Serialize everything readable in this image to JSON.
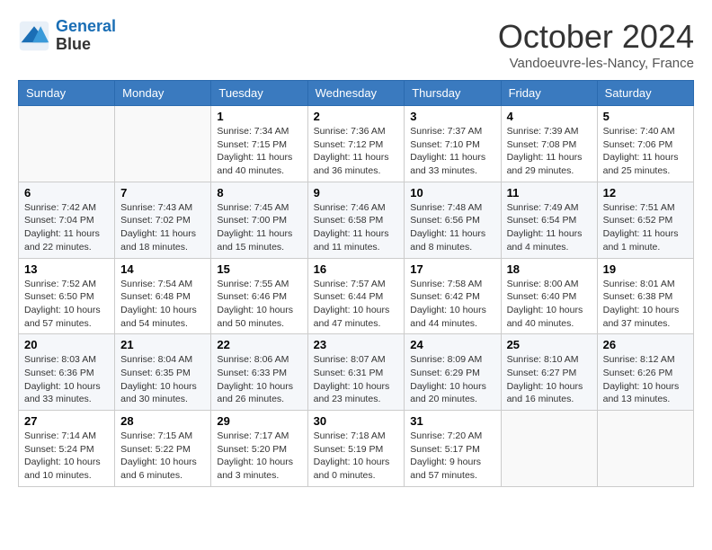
{
  "header": {
    "logo_line1": "General",
    "logo_line2": "Blue",
    "month_title": "October 2024",
    "subtitle": "Vandoeuvre-les-Nancy, France"
  },
  "weekdays": [
    "Sunday",
    "Monday",
    "Tuesday",
    "Wednesday",
    "Thursday",
    "Friday",
    "Saturday"
  ],
  "weeks": [
    [
      {
        "day": "",
        "sunrise": "",
        "sunset": "",
        "daylight": ""
      },
      {
        "day": "",
        "sunrise": "",
        "sunset": "",
        "daylight": ""
      },
      {
        "day": "1",
        "sunrise": "Sunrise: 7:34 AM",
        "sunset": "Sunset: 7:15 PM",
        "daylight": "Daylight: 11 hours and 40 minutes."
      },
      {
        "day": "2",
        "sunrise": "Sunrise: 7:36 AM",
        "sunset": "Sunset: 7:12 PM",
        "daylight": "Daylight: 11 hours and 36 minutes."
      },
      {
        "day": "3",
        "sunrise": "Sunrise: 7:37 AM",
        "sunset": "Sunset: 7:10 PM",
        "daylight": "Daylight: 11 hours and 33 minutes."
      },
      {
        "day": "4",
        "sunrise": "Sunrise: 7:39 AM",
        "sunset": "Sunset: 7:08 PM",
        "daylight": "Daylight: 11 hours and 29 minutes."
      },
      {
        "day": "5",
        "sunrise": "Sunrise: 7:40 AM",
        "sunset": "Sunset: 7:06 PM",
        "daylight": "Daylight: 11 hours and 25 minutes."
      }
    ],
    [
      {
        "day": "6",
        "sunrise": "Sunrise: 7:42 AM",
        "sunset": "Sunset: 7:04 PM",
        "daylight": "Daylight: 11 hours and 22 minutes."
      },
      {
        "day": "7",
        "sunrise": "Sunrise: 7:43 AM",
        "sunset": "Sunset: 7:02 PM",
        "daylight": "Daylight: 11 hours and 18 minutes."
      },
      {
        "day": "8",
        "sunrise": "Sunrise: 7:45 AM",
        "sunset": "Sunset: 7:00 PM",
        "daylight": "Daylight: 11 hours and 15 minutes."
      },
      {
        "day": "9",
        "sunrise": "Sunrise: 7:46 AM",
        "sunset": "Sunset: 6:58 PM",
        "daylight": "Daylight: 11 hours and 11 minutes."
      },
      {
        "day": "10",
        "sunrise": "Sunrise: 7:48 AM",
        "sunset": "Sunset: 6:56 PM",
        "daylight": "Daylight: 11 hours and 8 minutes."
      },
      {
        "day": "11",
        "sunrise": "Sunrise: 7:49 AM",
        "sunset": "Sunset: 6:54 PM",
        "daylight": "Daylight: 11 hours and 4 minutes."
      },
      {
        "day": "12",
        "sunrise": "Sunrise: 7:51 AM",
        "sunset": "Sunset: 6:52 PM",
        "daylight": "Daylight: 11 hours and 1 minute."
      }
    ],
    [
      {
        "day": "13",
        "sunrise": "Sunrise: 7:52 AM",
        "sunset": "Sunset: 6:50 PM",
        "daylight": "Daylight: 10 hours and 57 minutes."
      },
      {
        "day": "14",
        "sunrise": "Sunrise: 7:54 AM",
        "sunset": "Sunset: 6:48 PM",
        "daylight": "Daylight: 10 hours and 54 minutes."
      },
      {
        "day": "15",
        "sunrise": "Sunrise: 7:55 AM",
        "sunset": "Sunset: 6:46 PM",
        "daylight": "Daylight: 10 hours and 50 minutes."
      },
      {
        "day": "16",
        "sunrise": "Sunrise: 7:57 AM",
        "sunset": "Sunset: 6:44 PM",
        "daylight": "Daylight: 10 hours and 47 minutes."
      },
      {
        "day": "17",
        "sunrise": "Sunrise: 7:58 AM",
        "sunset": "Sunset: 6:42 PM",
        "daylight": "Daylight: 10 hours and 44 minutes."
      },
      {
        "day": "18",
        "sunrise": "Sunrise: 8:00 AM",
        "sunset": "Sunset: 6:40 PM",
        "daylight": "Daylight: 10 hours and 40 minutes."
      },
      {
        "day": "19",
        "sunrise": "Sunrise: 8:01 AM",
        "sunset": "Sunset: 6:38 PM",
        "daylight": "Daylight: 10 hours and 37 minutes."
      }
    ],
    [
      {
        "day": "20",
        "sunrise": "Sunrise: 8:03 AM",
        "sunset": "Sunset: 6:36 PM",
        "daylight": "Daylight: 10 hours and 33 minutes."
      },
      {
        "day": "21",
        "sunrise": "Sunrise: 8:04 AM",
        "sunset": "Sunset: 6:35 PM",
        "daylight": "Daylight: 10 hours and 30 minutes."
      },
      {
        "day": "22",
        "sunrise": "Sunrise: 8:06 AM",
        "sunset": "Sunset: 6:33 PM",
        "daylight": "Daylight: 10 hours and 26 minutes."
      },
      {
        "day": "23",
        "sunrise": "Sunrise: 8:07 AM",
        "sunset": "Sunset: 6:31 PM",
        "daylight": "Daylight: 10 hours and 23 minutes."
      },
      {
        "day": "24",
        "sunrise": "Sunrise: 8:09 AM",
        "sunset": "Sunset: 6:29 PM",
        "daylight": "Daylight: 10 hours and 20 minutes."
      },
      {
        "day": "25",
        "sunrise": "Sunrise: 8:10 AM",
        "sunset": "Sunset: 6:27 PM",
        "daylight": "Daylight: 10 hours and 16 minutes."
      },
      {
        "day": "26",
        "sunrise": "Sunrise: 8:12 AM",
        "sunset": "Sunset: 6:26 PM",
        "daylight": "Daylight: 10 hours and 13 minutes."
      }
    ],
    [
      {
        "day": "27",
        "sunrise": "Sunrise: 7:14 AM",
        "sunset": "Sunset: 5:24 PM",
        "daylight": "Daylight: 10 hours and 10 minutes."
      },
      {
        "day": "28",
        "sunrise": "Sunrise: 7:15 AM",
        "sunset": "Sunset: 5:22 PM",
        "daylight": "Daylight: 10 hours and 6 minutes."
      },
      {
        "day": "29",
        "sunrise": "Sunrise: 7:17 AM",
        "sunset": "Sunset: 5:20 PM",
        "daylight": "Daylight: 10 hours and 3 minutes."
      },
      {
        "day": "30",
        "sunrise": "Sunrise: 7:18 AM",
        "sunset": "Sunset: 5:19 PM",
        "daylight": "Daylight: 10 hours and 0 minutes."
      },
      {
        "day": "31",
        "sunrise": "Sunrise: 7:20 AM",
        "sunset": "Sunset: 5:17 PM",
        "daylight": "Daylight: 9 hours and 57 minutes."
      },
      {
        "day": "",
        "sunrise": "",
        "sunset": "",
        "daylight": ""
      },
      {
        "day": "",
        "sunrise": "",
        "sunset": "",
        "daylight": ""
      }
    ]
  ]
}
